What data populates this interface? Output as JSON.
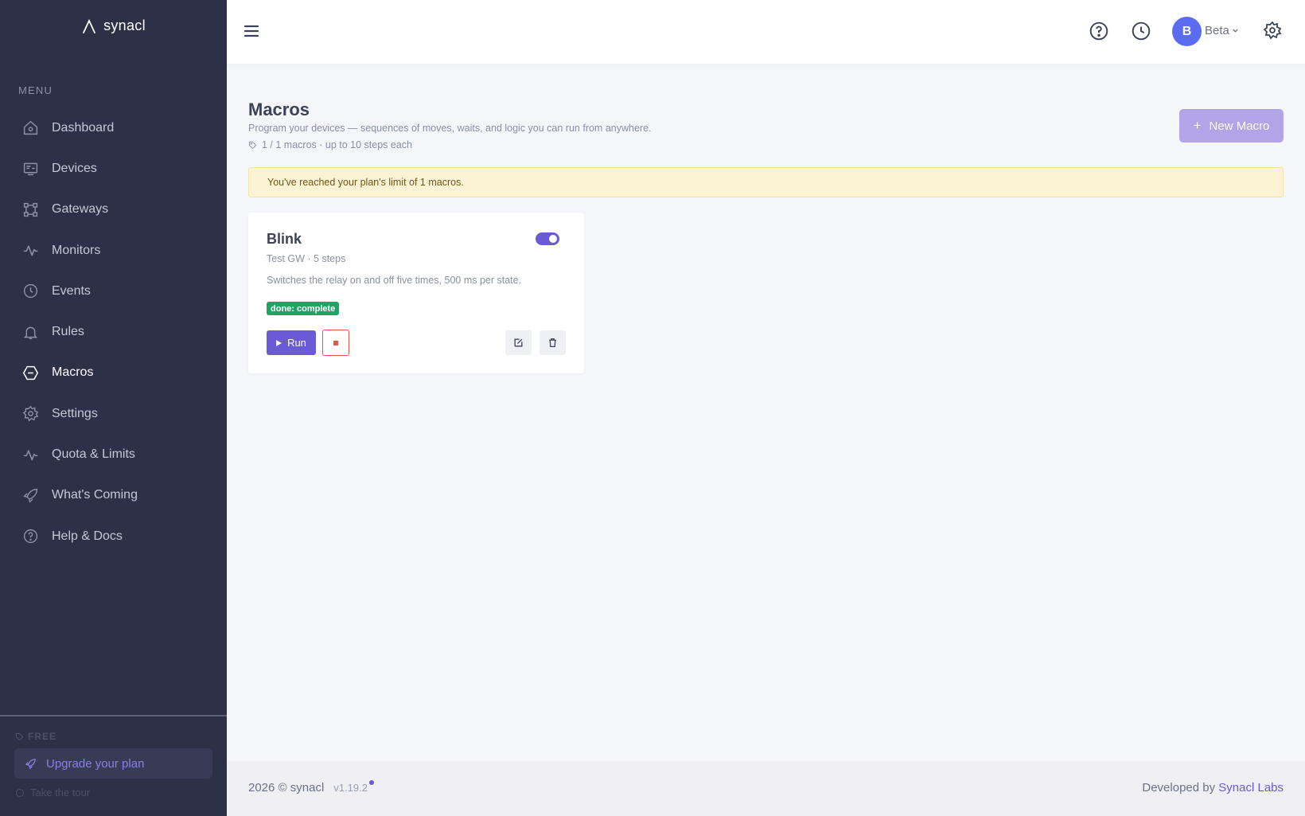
{
  "brand": {
    "name": "synacl"
  },
  "sidebar": {
    "menu_label": "MENU",
    "items": [
      {
        "label": "Dashboard",
        "icon": "home-icon"
      },
      {
        "label": "Devices",
        "icon": "devices-icon"
      },
      {
        "label": "Gateways",
        "icon": "gateway-icon"
      },
      {
        "label": "Monitors",
        "icon": "pulse-icon"
      },
      {
        "label": "Events",
        "icon": "clock-icon"
      },
      {
        "label": "Rules",
        "icon": "bell-icon"
      },
      {
        "label": "Macros",
        "icon": "hexagon-icon",
        "active": true
      },
      {
        "label": "Settings",
        "icon": "gear-icon"
      },
      {
        "label": "Quota & Limits",
        "icon": "pulse-icon"
      },
      {
        "label": "What's Coming",
        "icon": "rocket-icon"
      },
      {
        "label": "Help & Docs",
        "icon": "help-icon"
      }
    ],
    "plan_tier": "FREE",
    "upgrade_label": "Upgrade your plan",
    "tour_label": "Take the tour"
  },
  "header": {
    "avatar_initial": "B",
    "user_name": "Beta"
  },
  "page": {
    "title": "Macros",
    "subtitle": "Program your devices — sequences of moves, waits, and logic you can run from anywhere.",
    "usage": "1 / 1 macros · up to 10 steps each",
    "new_button": "New Macro",
    "alert": "You've reached your plan's limit of 1 macros."
  },
  "macro_card": {
    "name": "Blink",
    "meta": "Test GW · 5 steps",
    "description": "Switches the relay on and off five times, 500 ms per state.",
    "status": "done: complete",
    "enabled": true,
    "run_label": "Run"
  },
  "footer": {
    "copyright": "2026 © synacl",
    "version": "v1.19.2",
    "developed_by": "Developed by",
    "company": "Synacl Labs"
  },
  "colors": {
    "sidebar_bg": "#2c3147",
    "accent": "#6a5ad6",
    "success": "#1fa463",
    "alert_bg": "#fcf3d4"
  }
}
